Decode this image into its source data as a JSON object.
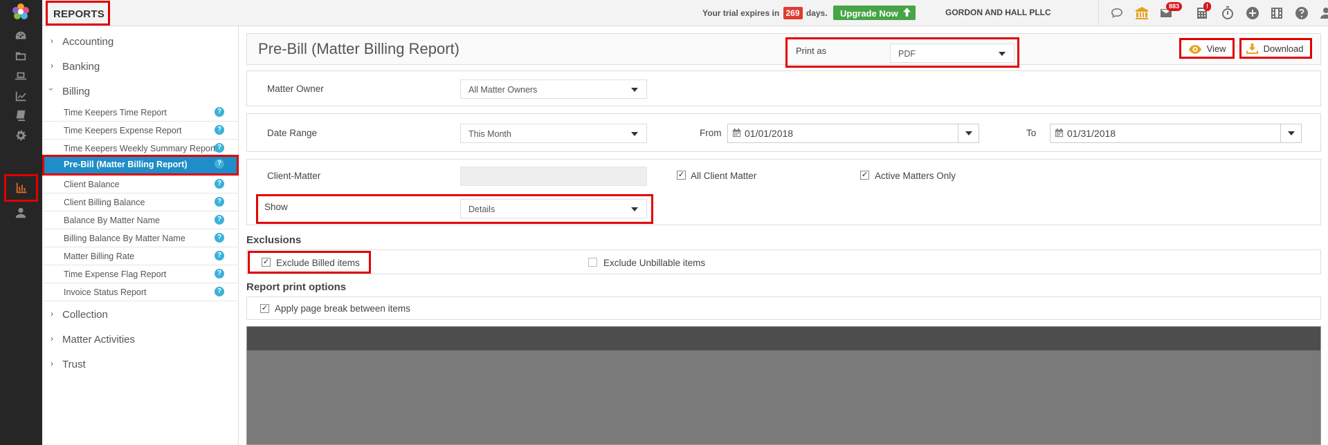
{
  "app": {
    "section_title": "REPORTS"
  },
  "topbar": {
    "trial_prefix": "Your trial expires in",
    "trial_days": "269",
    "trial_suffix": "days.",
    "upgrade_label": "Upgrade Now",
    "firm_name": "GORDON AND HALL PLLC",
    "icons": [
      "chat-icon",
      "bank-icon",
      "mail-icon",
      "calculator-icon",
      "stopwatch-icon",
      "add-icon",
      "film-icon",
      "help-icon",
      "user-icon",
      "lightbulb-icon"
    ],
    "mail_badge": "883",
    "calc_badge": "!"
  },
  "rail": {
    "icons": [
      "dashboard-icon",
      "folder-icon",
      "laptop-icon",
      "chart-line-icon",
      "book-icon",
      "settings-icon",
      "bar-chart-icon",
      "person-icon"
    ],
    "active": "bar-chart-icon"
  },
  "sidebar": {
    "groups": [
      {
        "label": "Accounting",
        "expanded": false
      },
      {
        "label": "Banking",
        "expanded": false
      },
      {
        "label": "Billing",
        "expanded": true
      },
      {
        "label": "Collection",
        "expanded": false
      },
      {
        "label": "Matter Activities",
        "expanded": false
      },
      {
        "label": "Trust",
        "expanded": false
      }
    ],
    "billing_items": [
      {
        "label": "Time Keepers Time Report"
      },
      {
        "label": "Time Keepers Expense Report"
      },
      {
        "label": "Time Keepers Weekly Summary Report"
      },
      {
        "label": "Pre-Bill (Matter Billing Report)",
        "active": true
      },
      {
        "label": "Client Balance"
      },
      {
        "label": "Client Billing Balance"
      },
      {
        "label": "Balance By Matter Name"
      },
      {
        "label": "Billing Balance By Matter Name"
      },
      {
        "label": "Matter Billing Rate"
      },
      {
        "label": "Time Expense Flag Report"
      },
      {
        "label": "Invoice Status Report"
      }
    ],
    "help_glyph": "?"
  },
  "report": {
    "title": "Pre-Bill (Matter Billing Report)",
    "print_as_label": "Print as",
    "print_as_value": "PDF",
    "view_label": "View",
    "download_label": "Download",
    "matter_owner_label": "Matter Owner",
    "matter_owner_value": "All Matter Owners",
    "date_range_label": "Date Range",
    "date_range_value": "This Month",
    "from_label": "From",
    "from_value": "01/01/2018",
    "to_label": "To",
    "to_value": "01/31/2018",
    "client_matter_label": "Client-Matter",
    "client_matter_value": "",
    "all_client_matter_label": "All Client Matter",
    "all_client_matter_checked": true,
    "active_matters_label": "Active Matters Only",
    "active_matters_checked": true,
    "show_label": "Show",
    "show_value": "Details",
    "exclusions_title": "Exclusions",
    "exclude_billed_label": "Exclude Billed items",
    "exclude_billed_checked": true,
    "exclude_unbillable_label": "Exclude Unbillable items",
    "exclude_unbillable_checked": false,
    "print_options_title": "Report print options",
    "page_break_label": "Apply page break between items",
    "page_break_checked": true
  },
  "colors": {
    "rail_bg": "#262626",
    "active_item_bg": "#1f8dc7",
    "highlight_border": "#e00000",
    "upgrade_bg": "#47a447",
    "help_dot": "#3cb1d9"
  }
}
